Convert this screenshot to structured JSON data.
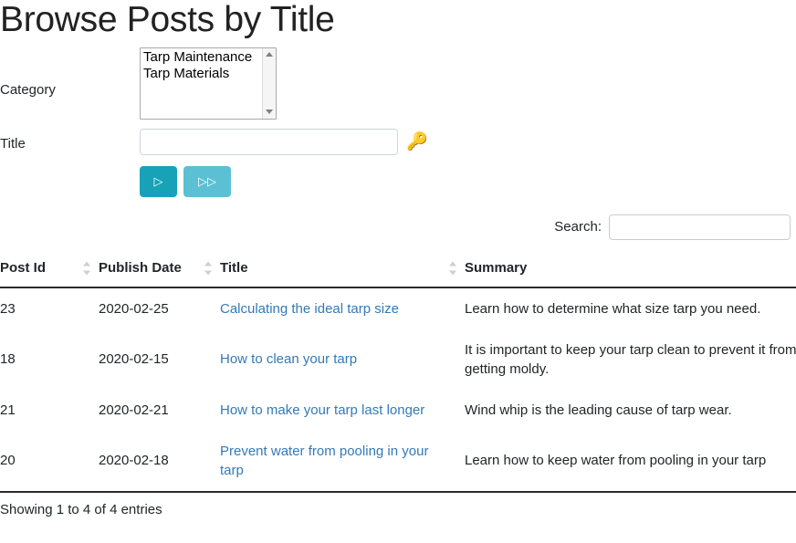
{
  "page": {
    "title": "Browse Posts by Title"
  },
  "form": {
    "category": {
      "label": "Category",
      "options": [
        "Tarp Maintenance",
        "Tarp Materials"
      ]
    },
    "title_filter": {
      "label": "Title",
      "value": "",
      "placeholder": ""
    },
    "key_icon": "key-icon",
    "buttons": {
      "go_label": "▷",
      "go_all_label": "▷▷"
    }
  },
  "search": {
    "label": "Search:",
    "value": "",
    "placeholder": ""
  },
  "table": {
    "columns": [
      {
        "label": "Post Id",
        "sort": "sortable"
      },
      {
        "label": "Publish Date",
        "sort": "sortable"
      },
      {
        "label": "Title",
        "sort": "sortable"
      },
      {
        "label": "Summary",
        "sort": "sortable"
      }
    ],
    "rows": [
      {
        "post_id": "23",
        "publish_date": "2020-02-25",
        "title": "Calculating the ideal tarp size",
        "summary": "Learn how to determine what size tarp you need."
      },
      {
        "post_id": "18",
        "publish_date": "2020-02-15",
        "title": "How to clean your tarp",
        "summary": "It is important to keep your tarp clean to prevent it from getting moldy."
      },
      {
        "post_id": "21",
        "publish_date": "2020-02-21",
        "title": "How to make your tarp last longer",
        "summary": "Wind whip is the leading cause of tarp wear."
      },
      {
        "post_id": "20",
        "publish_date": "2020-02-18",
        "title": "Prevent water from pooling in your tarp",
        "summary": "Learn how to keep water from pooling in your tarp"
      }
    ],
    "info": "Showing 1 to 4 of 4 entries"
  },
  "colors": {
    "link": "#337ab7",
    "button_primary": "#17a2b8",
    "button_secondary": "#5bc0d3",
    "key_icon": "#f0a90e"
  }
}
